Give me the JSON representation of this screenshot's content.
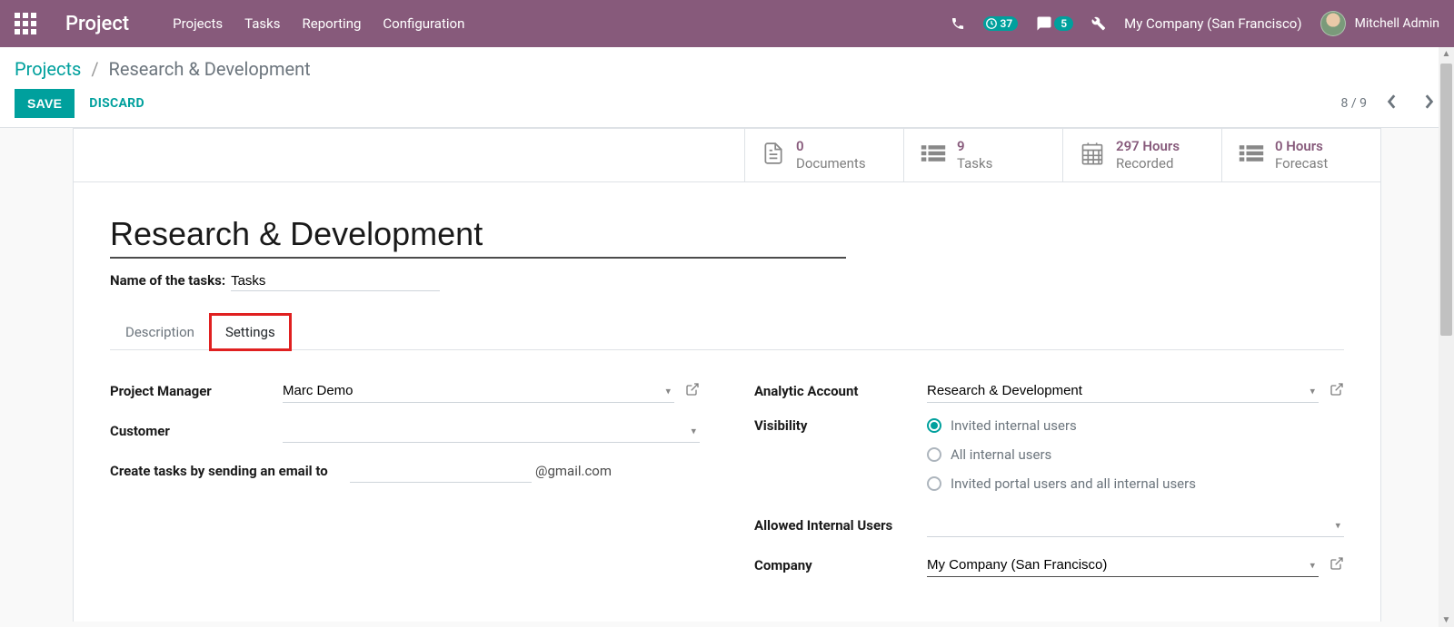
{
  "navbar": {
    "brand": "Project",
    "menu": [
      "Projects",
      "Tasks",
      "Reporting",
      "Configuration"
    ],
    "timer_badge": "37",
    "msg_badge": "5",
    "company": "My Company (San Francisco)",
    "user": "Mitchell Admin"
  },
  "breadcrumb": {
    "root": "Projects",
    "current": "Research & Development"
  },
  "controls": {
    "save": "SAVE",
    "discard": "DISCARD",
    "pager": "8 / 9"
  },
  "stats": [
    {
      "value": "0",
      "label": "Documents",
      "icon": "document"
    },
    {
      "value": "9",
      "label": "Tasks",
      "icon": "tasks"
    },
    {
      "value": "297 Hours",
      "label": "Recorded",
      "icon": "calendar"
    },
    {
      "value": "0 Hours",
      "label": "Forecast",
      "icon": "forecast"
    }
  ],
  "form": {
    "title": "Research & Development",
    "name_of_tasks_label": "Name of the tasks:",
    "name_of_tasks_value": "Tasks",
    "tabs": [
      "Description",
      "Settings"
    ],
    "active_tab": 1,
    "left_fields": {
      "project_manager_label": "Project Manager",
      "project_manager_value": "Marc Demo",
      "customer_label": "Customer",
      "customer_value": "",
      "email_label": "Create tasks by sending an email to",
      "email_value": "",
      "email_suffix": "@gmail.com"
    },
    "right_fields": {
      "analytic_label": "Analytic Account",
      "analytic_value": "Research & Development",
      "visibility_label": "Visibility",
      "visibility_options": [
        "Invited internal users",
        "All internal users",
        "Invited portal users and all internal users"
      ],
      "visibility_selected": 0,
      "allowed_users_label": "Allowed Internal Users",
      "allowed_users_value": "",
      "company_label": "Company",
      "company_value": "My Company (San Francisco)"
    }
  }
}
